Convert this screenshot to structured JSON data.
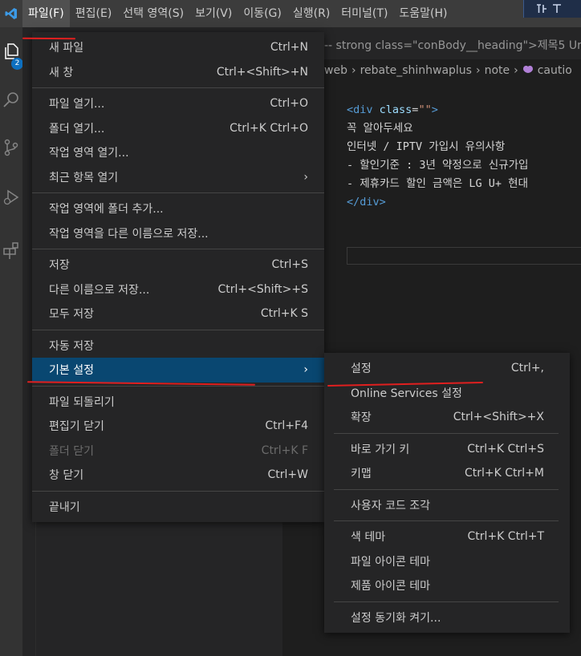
{
  "menubar": {
    "items": [
      {
        "label": "파일(F)"
      },
      {
        "label": "편집(E)"
      },
      {
        "label": "선택 영역(S)"
      },
      {
        "label": "보기(V)"
      },
      {
        "label": "이동(G)"
      },
      {
        "label": "실행(R)"
      },
      {
        "label": "터미널(T)"
      },
      {
        "label": "도움말(H)"
      }
    ]
  },
  "activity": {
    "explorer_badge": "2"
  },
  "editor": {
    "tab_text": "-- strong class=\"conBody__heading\">제목5  Ur",
    "breadcrumb": [
      "web",
      "rebate_shinhwaplus",
      "note",
      "cautio"
    ],
    "code": {
      "line1_tag_open": "<div",
      "line1_attr": " class",
      "line1_eq": "=",
      "line1_str": "\"\"",
      "line1_tag_close": ">",
      "line2": "꼭 알아두세요",
      "line3": "인터넷 / IPTV 가입시 유의사항",
      "line4": "- 할인기준 : 3년 약정으로 신규가입",
      "line5": "- 제휴카드 할인 금액은 LG U+ 현대",
      "line6": "</div>"
    }
  },
  "file_menu": {
    "items": [
      {
        "label": "새 파일",
        "shortcut": "Ctrl+N"
      },
      {
        "label": "새 창",
        "shortcut": "Ctrl+<Shift>+N"
      },
      {
        "label": "파일 열기...",
        "shortcut": "Ctrl+O"
      },
      {
        "label": "폴더 열기...",
        "shortcut": "Ctrl+K Ctrl+O"
      },
      {
        "label": "작업 영역 열기...",
        "shortcut": ""
      },
      {
        "label": "최근 항목 열기",
        "shortcut": ""
      },
      {
        "label": "작업 영역에 폴더 추가...",
        "shortcut": ""
      },
      {
        "label": "작업 영역을 다른 이름으로 저장...",
        "shortcut": ""
      },
      {
        "label": "저장",
        "shortcut": "Ctrl+S"
      },
      {
        "label": "다른 이름으로 저장...",
        "shortcut": "Ctrl+<Shift>+S"
      },
      {
        "label": "모두 저장",
        "shortcut": "Ctrl+K S"
      },
      {
        "label": "자동 저장",
        "shortcut": ""
      },
      {
        "label": "기본 설정",
        "shortcut": ""
      },
      {
        "label": "파일 되돌리기",
        "shortcut": ""
      },
      {
        "label": "편집기 닫기",
        "shortcut": "Ctrl+F4"
      },
      {
        "label": "폴더 닫기",
        "shortcut": "Ctrl+K F"
      },
      {
        "label": "창 닫기",
        "shortcut": "Ctrl+W"
      },
      {
        "label": "끝내기",
        "shortcut": ""
      }
    ]
  },
  "pref_menu": {
    "items": [
      {
        "label": "설정",
        "shortcut": "Ctrl+,"
      },
      {
        "label": "Online Services 설정",
        "shortcut": ""
      },
      {
        "label": "확장",
        "shortcut": "Ctrl+<Shift>+X"
      },
      {
        "label": "바로 가기 키",
        "shortcut": "Ctrl+K Ctrl+S"
      },
      {
        "label": "키맵",
        "shortcut": "Ctrl+K Ctrl+M"
      },
      {
        "label": "사용자 코드 조각",
        "shortcut": ""
      },
      {
        "label": "색 테마",
        "shortcut": "Ctrl+K Ctrl+T"
      },
      {
        "label": "파일 아이콘 테마",
        "shortcut": ""
      },
      {
        "label": "제품 아이콘 테마",
        "shortcut": ""
      },
      {
        "label": "설정 동기화 켜기...",
        "shortcut": ""
      }
    ]
  },
  "colors": {
    "accent": "#094771",
    "menu_bg": "#252526",
    "annotation": "#e11f1f",
    "vscode_blue": "#3c9ae6"
  }
}
